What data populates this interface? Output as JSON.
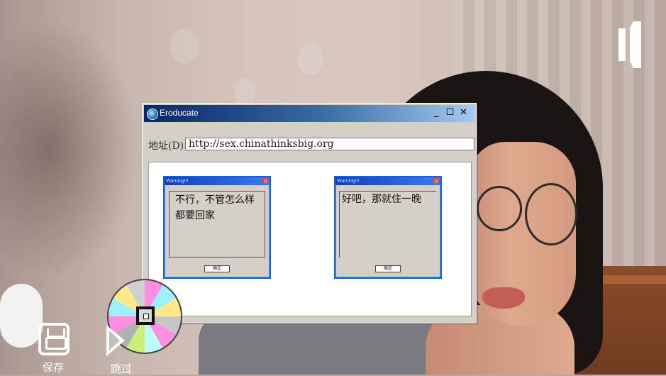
{
  "window": {
    "title": "Eroducate",
    "address_label": "地址(D)",
    "address_value": "http://sex.chinathinksbig.org"
  },
  "dialogs": [
    {
      "title": "Warning!!!",
      "close": "X",
      "lines": [
        "不行，不管怎么样",
        "都要回家"
      ],
      "button": "确定"
    },
    {
      "title": "Warning!!!",
      "close": "X",
      "lines": [
        "好吧，那就住一晚"
      ],
      "button": "确定"
    }
  ],
  "hud": {
    "save_label": "保存",
    "skip_label": "跳过"
  },
  "icons": {
    "pause": "pause-icon",
    "save": "floppy-disk-icon",
    "skip": "play-triangle-icon",
    "loading": "spinning-disc-icon"
  },
  "colors": {
    "titlebar_start": "#0a246a",
    "titlebar_end": "#a6caf0",
    "dialog_border": "#1a5fd6",
    "window_face": "#d4d0c8"
  }
}
